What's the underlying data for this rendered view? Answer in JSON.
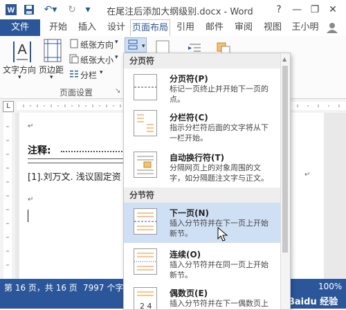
{
  "window": {
    "title": "在尾注后添加大纲级别.docx - Word",
    "help": "?",
    "minimize": "—",
    "restore": "❐",
    "close": "✕"
  },
  "tabs": [
    {
      "label": "文件"
    },
    {
      "label": "开始"
    },
    {
      "label": "插入"
    },
    {
      "label": "设计"
    },
    {
      "label": "页面布局"
    },
    {
      "label": "引用"
    },
    {
      "label": "邮件"
    },
    {
      "label": "审阅"
    },
    {
      "label": "视图"
    },
    {
      "label": "王小明"
    }
  ],
  "ribbon": {
    "text_direction": "文字方向",
    "margins": "页边距",
    "orientation": "纸张方向",
    "size": "纸张大小",
    "columns": "分栏",
    "group_label": "页面设置"
  },
  "document": {
    "heading": "注释:",
    "endnote": "[1].刘万文. 浅议固定资",
    "para_mark": "↵"
  },
  "status": {
    "page": "第 16 页，共 16 页",
    "words": "7997 个字",
    "zoom": "100%"
  },
  "menu": {
    "section1": "分页符",
    "section2": "分节符",
    "items": [
      {
        "title": "分页符(P)",
        "desc": "标记一页终止并开始下一页的点。"
      },
      {
        "title": "分栏符(C)",
        "desc": "指示分栏符后面的文字将从下一栏开始。"
      },
      {
        "title": "自动换行符(T)",
        "desc": "分隔网页上的对象周围的文字，如分隔题注文字与正文。"
      },
      {
        "title": "下一页(N)",
        "desc": "插入分节符并在下一页上开始新节。"
      },
      {
        "title": "连续(O)",
        "desc": "插入分节符并在同一页上开始新节。"
      },
      {
        "title": "偶数页(E)",
        "desc": "插入分节符并在下一偶数页上"
      }
    ]
  },
  "watermark": "Baidu 经验"
}
